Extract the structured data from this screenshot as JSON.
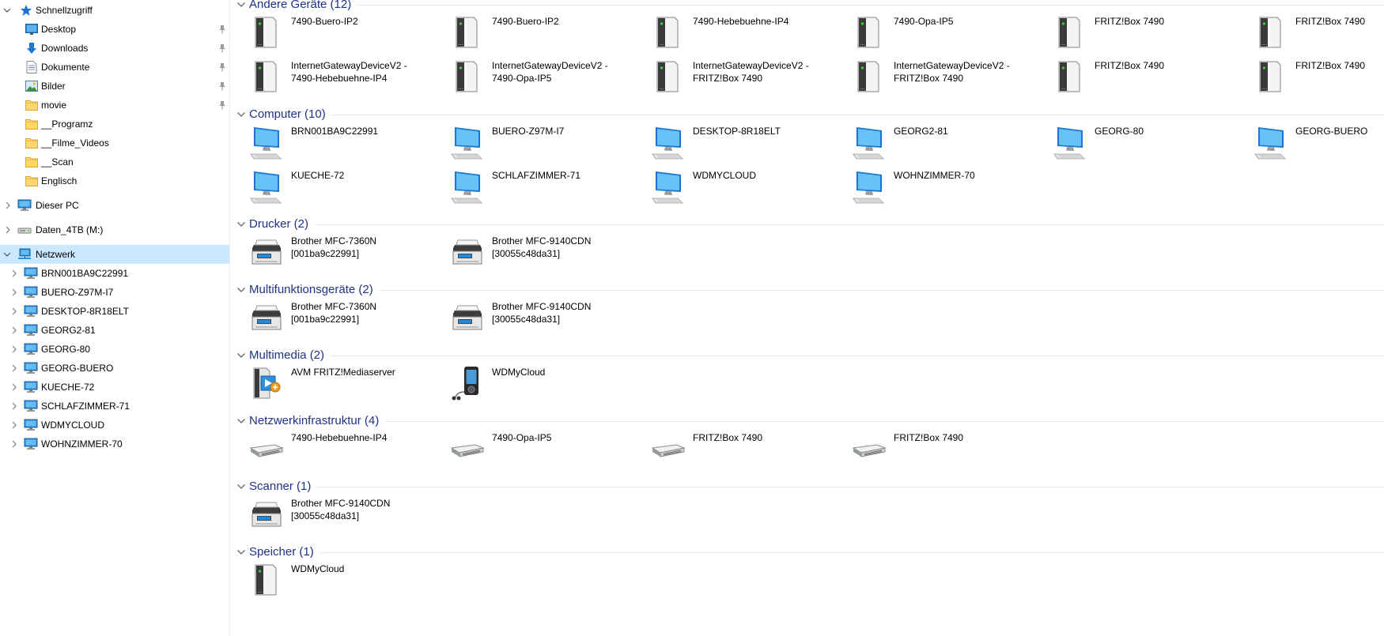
{
  "navigation": {
    "quick_access": {
      "label": "Schnellzugriff",
      "items": [
        {
          "label": "Desktop",
          "icon": "desktop-folder-icon",
          "pinned": true
        },
        {
          "label": "Downloads",
          "icon": "downloads-icon",
          "pinned": true
        },
        {
          "label": "Dokumente",
          "icon": "documents-icon",
          "pinned": true
        },
        {
          "label": "Bilder",
          "icon": "pictures-icon",
          "pinned": true
        },
        {
          "label": "movie",
          "icon": "folder-icon",
          "pinned": true
        },
        {
          "label": "__Programz",
          "icon": "folder-icon",
          "pinned": false
        },
        {
          "label": "__Filme_Videos",
          "icon": "folder-icon",
          "pinned": false
        },
        {
          "label": "__Scan",
          "icon": "folder-icon",
          "pinned": false
        },
        {
          "label": "Englisch",
          "icon": "folder-icon",
          "pinned": false
        }
      ]
    },
    "this_pc": {
      "label": "Dieser PC"
    },
    "drive": {
      "label": "Daten_4TB (M:)"
    },
    "network": {
      "label": "Netzwerk",
      "computers": [
        "BRN001BA9C22991",
        "BUERO-Z97M-I7",
        "DESKTOP-8R18ELT",
        "GEORG2-81",
        "GEORG-80",
        "GEORG-BUERO",
        "KUECHE-72",
        "SCHLAFZIMMER-71",
        "WDMYCLOUD",
        "WOHNZIMMER-70"
      ]
    }
  },
  "groups": [
    {
      "label": "Andere Geräte (12)",
      "icon": "device-tower-icon",
      "items": [
        "7490-Buero-IP2",
        "7490-Buero-IP2",
        "7490-Hebebuehne-IP4",
        "7490-Opa-IP5",
        "FRITZ!Box 7490",
        "FRITZ!Box 7490",
        "InternetGatewayDeviceV2 -\n7490-Hebebuehne-IP4",
        "InternetGatewayDeviceV2 -\n7490-Opa-IP5",
        "InternetGatewayDeviceV2 -\nFRITZ!Box 7490",
        "InternetGatewayDeviceV2 -\nFRITZ!Box 7490",
        "FRITZ!Box 7490",
        "FRITZ!Box 7490"
      ]
    },
    {
      "label": "Computer (10)",
      "icon": "computer-icon",
      "items": [
        "BRN001BA9C22991",
        "BUERO-Z97M-I7",
        "DESKTOP-8R18ELT",
        "GEORG2-81",
        "GEORG-80",
        "GEORG-BUERO",
        "KUECHE-72",
        "SCHLAFZIMMER-71",
        "WDMYCLOUD",
        "WOHNZIMMER-70"
      ]
    },
    {
      "label": "Drucker (2)",
      "icon": "printer-icon",
      "items": [
        "Brother MFC-7360N\n[001ba9c22991]",
        "Brother MFC-9140CDN\n[30055c48da31]"
      ]
    },
    {
      "label": "Multifunktionsgeräte (2)",
      "icon": "printer-icon",
      "items": [
        "Brother MFC-7360N\n[001ba9c22991]",
        "Brother MFC-9140CDN\n[30055c48da31]"
      ]
    },
    {
      "label": "Multimedia (2)",
      "icon": "media-server-icon",
      "items": [
        "AVM FRITZ!Mediaserver",
        "WDMyCloud"
      ],
      "item_icons": [
        "media-server-icon",
        "media-player-icon"
      ]
    },
    {
      "label": "Netzwerkinfrastruktur (4)",
      "icon": "router-icon",
      "items": [
        "7490-Hebebuehne-IP4",
        "7490-Opa-IP5",
        "FRITZ!Box 7490",
        "FRITZ!Box 7490"
      ]
    },
    {
      "label": "Scanner (1)",
      "icon": "printer-icon",
      "items": [
        "Brother MFC-9140CDN\n[30055c48da31]"
      ]
    },
    {
      "label": "Speicher (1)",
      "icon": "device-tower-icon",
      "items": [
        "WDMyCloud"
      ]
    }
  ],
  "colors": {
    "group_header": "#1e3287",
    "selection": "#cce8ff",
    "separator": "#e5e5e5"
  }
}
